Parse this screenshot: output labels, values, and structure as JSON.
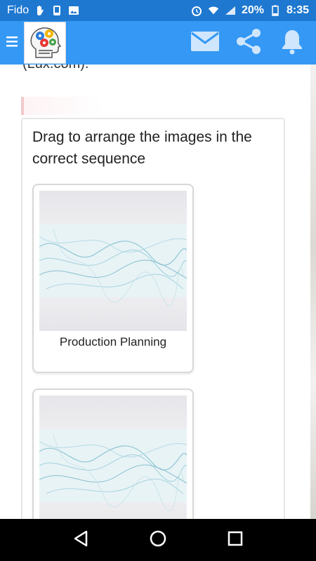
{
  "status_bar": {
    "carrier": "Fido",
    "battery": "20%",
    "time": "8:35",
    "left_icons": [
      "hand-icon",
      "phone-icon",
      "image-icon"
    ],
    "right_icons": [
      "alarm-icon",
      "wifi-icon",
      "signal-icon",
      "battery-icon"
    ]
  },
  "app_bar": {
    "menu_icon": "menu-icon",
    "logo_icon": "brain-gears-logo",
    "actions": [
      "mail-icon",
      "share-icon",
      "bell-icon"
    ]
  },
  "content": {
    "cut_text": "(Lux.com).",
    "instruction": "Drag to arrange the images in the correct sequence",
    "cards": [
      {
        "caption": "Production Planning"
      },
      {
        "caption": ""
      }
    ]
  },
  "nav_bar": {
    "buttons": [
      "back-icon",
      "home-icon",
      "recents-icon"
    ]
  },
  "colors": {
    "status_bar": "#1e78d0",
    "app_bar": "#3498f4",
    "accent": "#3498f4"
  }
}
